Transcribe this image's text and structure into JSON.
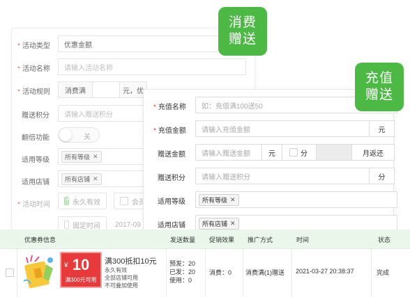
{
  "panel_a": {
    "activity_type_label": "活动类型",
    "activity_type_value": "优惠金额",
    "activity_name_label": "活动名称",
    "activity_name_placeholder": "请输入活动名称",
    "activity_rule_label": "活动规则",
    "rule_prefix": "消费满",
    "rule_mid": "元，优",
    "gift_points_label": "赠送积分",
    "gift_points_placeholder": "请输入赠送积分",
    "double_label": "翻倍功能",
    "double_toggle_text": "关",
    "level_label": "适用等级",
    "level_tag": "所有等级",
    "store_label": "适用店铺",
    "store_tag": "所有店铺",
    "time_label": "活动时间",
    "permanent_label": "永久有效",
    "member_label": "会员",
    "fixed_time_label": "固定时间",
    "fixed_time_value": "2017-09"
  },
  "badge_a": {
    "line1": "消费",
    "line2": "赠送"
  },
  "badge_b": {
    "line1": "充值",
    "line2": "赠送"
  },
  "panel_b": {
    "recharge_name_label": "充值名称",
    "recharge_name_placeholder": "如：充值满100送50",
    "recharge_amount_label": "充值金额",
    "recharge_amount_placeholder": "请输入充值金额",
    "yuan": "元",
    "gift_amount_label": "赠送金额",
    "gift_amount_placeholder": "请输入赠送金额",
    "fen": "分",
    "monthly_return": "月返还",
    "gift_points_label": "赠送积分",
    "gift_points_placeholder": "请输入赠送积分",
    "level_label": "适用等级",
    "level_tag": "所有等级",
    "store_label": "适用店铺",
    "store_tag": "所有店铺"
  },
  "table": {
    "headers": [
      "优惠券信息",
      "发送数量",
      "促销效果",
      "推广方式",
      "时间",
      "状态"
    ],
    "row": {
      "coupon_value": "10",
      "coupon_currency": "¥",
      "coupon_sub": "满300元可用",
      "title": "满300抵扣10元",
      "line1": "永久有效",
      "line2": "全部店铺可用",
      "line3": "不可叠加使用",
      "send_planned": "预发：20",
      "send_sent": "已发：20",
      "send_used": "使用：0",
      "effect": "消费：0",
      "promo": "消费满(1)赠送",
      "time": "2021-03-27 20:38:37",
      "status": "完成"
    }
  },
  "colors": {
    "accent": "#4cb945",
    "required": "#e63b3b",
    "header_bg": "#eaf6ea",
    "coupon": "#e83a3a"
  }
}
